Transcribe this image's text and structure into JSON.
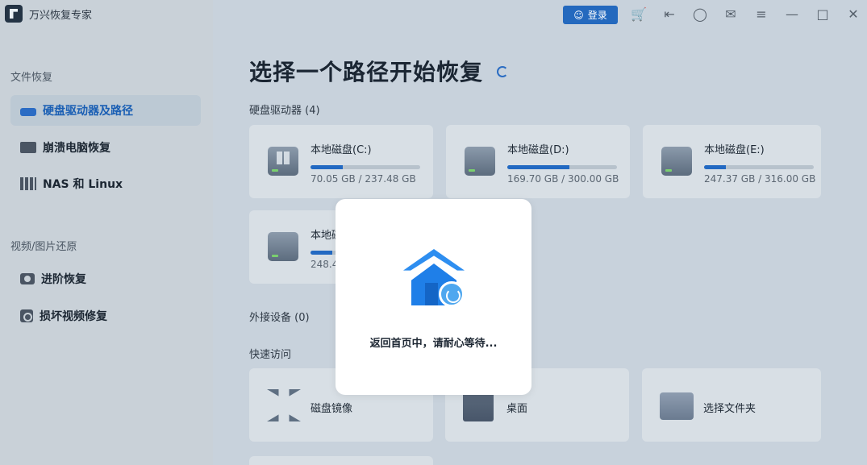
{
  "app": {
    "name": "万兴恢复专家"
  },
  "topbar": {
    "login_label": "登录",
    "icons": [
      "user-icon",
      "cart-icon",
      "export-icon",
      "headset-icon",
      "mail-icon",
      "menu-icon",
      "minimize-icon",
      "maximize-icon",
      "close-icon"
    ]
  },
  "sidebar": {
    "section1": "文件恢复",
    "section2": "视频/图片还原",
    "items": [
      {
        "label": "硬盘驱动器及路径",
        "icon": "hard-drive-icon"
      },
      {
        "label": "崩溃电脑恢复",
        "icon": "monitor-icon"
      },
      {
        "label": "NAS 和 Linux",
        "icon": "nas-icon"
      },
      {
        "label": "进阶恢复",
        "icon": "camera-icon"
      },
      {
        "label": "损坏视频修复",
        "icon": "video-repair-icon"
      }
    ]
  },
  "main": {
    "title": "选择一个路径开始恢复",
    "drives_label": "硬盘驱动器 (4)",
    "external_label": "外接设备 (0)",
    "quick_label": "快速访问",
    "drives": [
      {
        "name": "本地磁盘(C:)",
        "size": "70.05 GB / 237.48 GB",
        "used_fraction": 0.295
      },
      {
        "name": "本地磁盘(D:)",
        "size": "169.70 GB / 300.00 GB",
        "used_fraction": 0.566
      },
      {
        "name": "本地磁盘(E:)",
        "size": "247.37 GB / 316.00 GB",
        "used_fraction": 0.2
      },
      {
        "name": "本地磁",
        "size": "248.4",
        "used_fraction": 0.2
      }
    ],
    "quick": [
      {
        "name": "磁盘镜像",
        "icon": "disk-image-icon"
      },
      {
        "name": "桌面",
        "icon": "desktop-icon"
      },
      {
        "name": "选择文件夹",
        "icon": "folder-icon"
      }
    ]
  },
  "modal": {
    "text": "返回首页中，请耐心等待..."
  }
}
